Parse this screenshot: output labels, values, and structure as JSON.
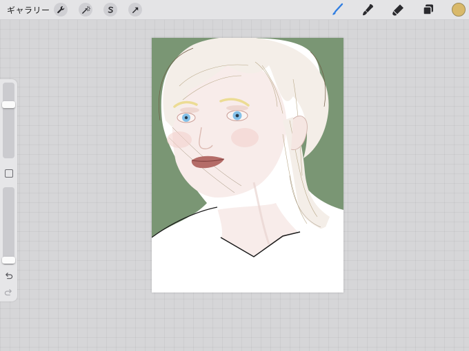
{
  "toolbar": {
    "gallery_label": "ギャラリー",
    "left_tools": [
      "wrench-icon",
      "magic-wand-icon",
      "selection-icon",
      "transform-arrow-icon"
    ],
    "right_tools": [
      "brush-icon",
      "smudge-icon",
      "eraser-icon",
      "layers-icon"
    ],
    "active_tool": "brush-icon",
    "current_color": "#d9b96a"
  },
  "sidebar": {
    "brush_size_level": 0.73,
    "opacity_level": 0.02,
    "controls": [
      "brush-size-slider",
      "modify-button",
      "opacity-slider",
      "undo-button",
      "redo-button"
    ]
  },
  "canvas": {
    "content": "artwork-portrait",
    "background_color": "#7a9674",
    "colors": {
      "skin": "#f8ecea",
      "hair": "#f4eee8",
      "shirt": "#ffffff",
      "eyes": "#84c0e8",
      "lips": "#b46c68",
      "brows": "#ecdc94",
      "line": "#6e5a42"
    }
  }
}
